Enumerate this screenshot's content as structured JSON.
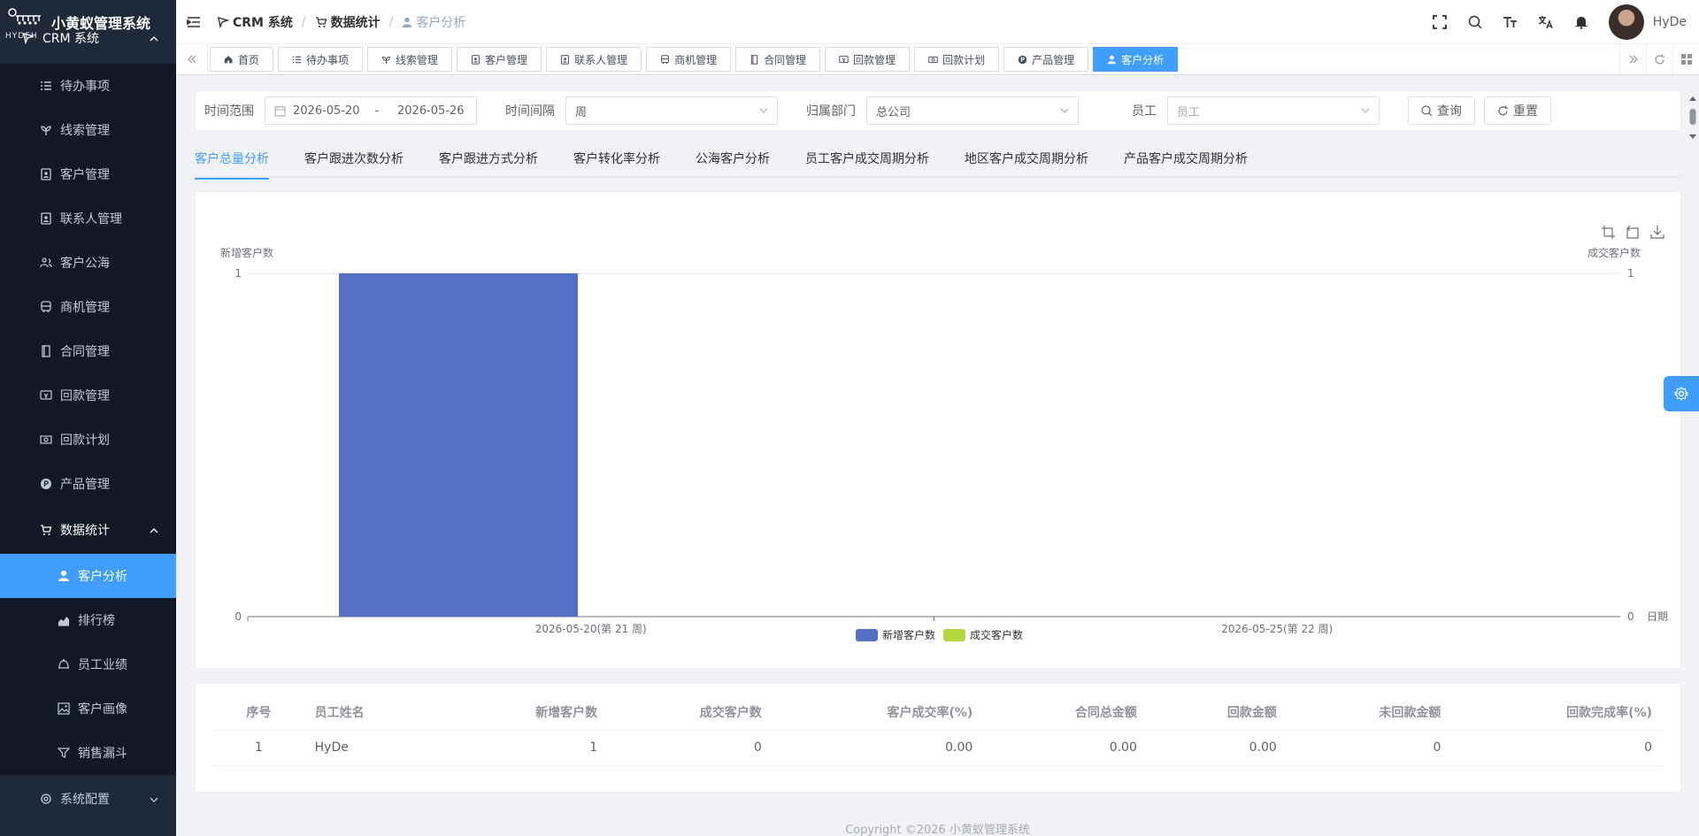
{
  "app": {
    "title": "小黄蚁管理系统",
    "logo_text": "HYDEH"
  },
  "sidebar": {
    "system": "CRM 系统",
    "items": [
      {
        "label": "待办事项",
        "icon": "list-check-icon"
      },
      {
        "label": "线索管理",
        "icon": "leaf-icon"
      },
      {
        "label": "客户管理",
        "icon": "contact-card-icon"
      },
      {
        "label": "联系人管理",
        "icon": "contact-card-icon"
      },
      {
        "label": "客户公海",
        "icon": "users-icon"
      },
      {
        "label": "商机管理",
        "icon": "bus-icon"
      },
      {
        "label": "合同管理",
        "icon": "document-icon"
      },
      {
        "label": "回款管理",
        "icon": "money-icon"
      },
      {
        "label": "回款计划",
        "icon": "money-plan-icon"
      },
      {
        "label": "产品管理",
        "icon": "product-icon"
      }
    ],
    "stats_group": "数据统计",
    "stats_items": [
      {
        "label": "客户分析",
        "icon": "user-icon"
      },
      {
        "label": "排行榜",
        "icon": "area-chart-icon"
      },
      {
        "label": "员工业绩",
        "icon": "bell-icon"
      },
      {
        "label": "客户画像",
        "icon": "image-icon"
      },
      {
        "label": "销售漏斗",
        "icon": "funnel-icon"
      }
    ],
    "config_group": "系统配置"
  },
  "header": {
    "breadcrumb": [
      "CRM 系统",
      "数据统计",
      "客户分析"
    ],
    "username": "HyDe"
  },
  "tags": [
    "首页",
    "待办事项",
    "线索管理",
    "客户管理",
    "联系人管理",
    "商机管理",
    "合同管理",
    "回款管理",
    "回款计划",
    "产品管理",
    "客户分析"
  ],
  "filter": {
    "time_range_label": "时间范围",
    "date_start": "2026-05-20",
    "date_sep": "-",
    "date_end": "2026-05-26",
    "interval_label": "时间间隔",
    "interval_value": "周",
    "dept_label": "归属部门",
    "dept_value": "总公司",
    "employee_label": "员工",
    "employee_placeholder": "员工",
    "query_label": "查询",
    "reset_label": "重置"
  },
  "tabs": [
    "客户总量分析",
    "客户跟进次数分析",
    "客户跟进方式分析",
    "客户转化率分析",
    "公海客户分析",
    "员工客户成交周期分析",
    "地区客户成交周期分析",
    "产品客户成交周期分析"
  ],
  "chart_data": {
    "type": "bar",
    "categories": [
      "2026-05-20(第 21 周)",
      "2026-05-25(第 22 周)"
    ],
    "series": [
      {
        "name": "新增客户数",
        "values": [
          1,
          0
        ],
        "color": "#5470c6"
      },
      {
        "name": "成交客户数",
        "values": [
          0,
          0
        ],
        "color": "#b5d63c"
      }
    ],
    "ylabel_left": "新增客户数",
    "ylabel_right": "成交客户数",
    "xlabel": "日期",
    "ylim": [
      0,
      1
    ],
    "yticks_left": [
      "0",
      "1"
    ],
    "yticks_right": [
      "0",
      "1"
    ],
    "legend": "bottom-center"
  },
  "table": {
    "headers": [
      "序号",
      "员工姓名",
      "新增客户数",
      "成交客户数",
      "客户成交率(%)",
      "合同总金额",
      "回款金额",
      "未回款金额",
      "回款完成率(%)"
    ],
    "rows": [
      [
        "1",
        "HyDe",
        "1",
        "0",
        "0.00",
        "0.00",
        "0.00",
        "0",
        "0"
      ]
    ]
  },
  "footer": {
    "copyright": "Copyright ©2026 小黄蚁管理系统"
  }
}
